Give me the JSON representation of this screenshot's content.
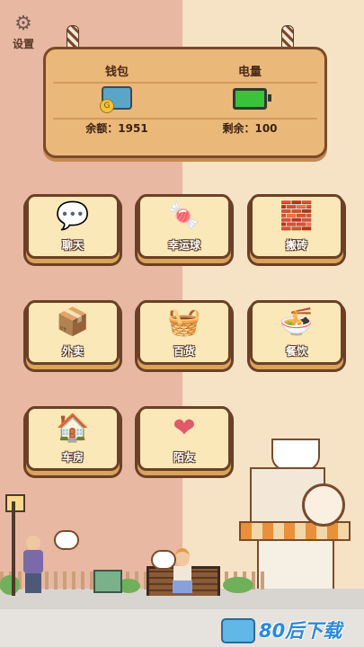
{
  "settings": {
    "label": "设置",
    "icon": "gear-icon"
  },
  "wallet": {
    "title": "钱包",
    "balance_label": "余额：",
    "balance": "1951",
    "icon": "wallet-icon"
  },
  "battery": {
    "title": "电量",
    "remaining_label": "剩余：",
    "remaining": "100",
    "icon": "battery-icon",
    "level_percent": 100
  },
  "menu": [
    {
      "label": "聊天",
      "icon": "chat-icon"
    },
    {
      "label": "幸运球",
      "icon": "gumball-machine-icon"
    },
    {
      "label": "搬砖",
      "icon": "wheelbarrow-icon"
    },
    {
      "label": "外卖",
      "icon": "delivery-box-icon"
    },
    {
      "label": "百货",
      "icon": "shopping-basket-icon"
    },
    {
      "label": "餐饮",
      "icon": "food-bowl-icon"
    },
    {
      "label": "车房",
      "icon": "house-car-icon"
    },
    {
      "label": "陌友",
      "icon": "heart-hands-icon"
    }
  ],
  "watermark": {
    "text": "80后下载",
    "icon": "cassette-icon"
  },
  "colors": {
    "left_bg": "#e9b8a2",
    "right_bg": "#f6e3c6",
    "board": "#eab879",
    "tile": "#fbe8b8",
    "outline": "#6a4026",
    "battery_green": "#3bc23b"
  }
}
